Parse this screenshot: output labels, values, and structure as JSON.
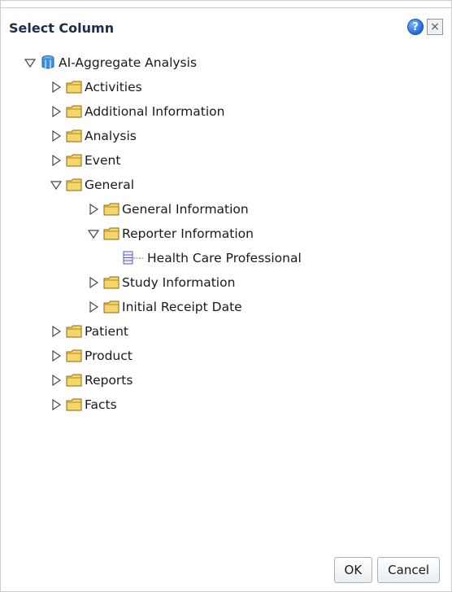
{
  "dialog": {
    "title": "Select Column",
    "help_icon_glyph": "?",
    "close_icon_glyph": "×"
  },
  "tree": {
    "root": {
      "label": "AI-Aggregate Analysis",
      "expanded": true,
      "icon": "cube-icon"
    },
    "items": [
      {
        "label": "Activities",
        "level": 1,
        "expanded": false,
        "icon": "folder-icon"
      },
      {
        "label": "Additional Information",
        "level": 1,
        "expanded": false,
        "icon": "folder-icon"
      },
      {
        "label": "Analysis",
        "level": 1,
        "expanded": false,
        "icon": "folder-icon"
      },
      {
        "label": "Event",
        "level": 1,
        "expanded": false,
        "icon": "folder-icon"
      },
      {
        "label": "General",
        "level": 1,
        "expanded": true,
        "icon": "folder-icon"
      },
      {
        "label": "General Information",
        "level": 2,
        "expanded": false,
        "icon": "folder-icon"
      },
      {
        "label": "Reporter Information",
        "level": 2,
        "expanded": true,
        "icon": "folder-icon"
      },
      {
        "label": "Health Care Professional",
        "level": 3,
        "leaf": true,
        "icon": "column-icon"
      },
      {
        "label": "Study Information",
        "level": 2,
        "expanded": false,
        "icon": "folder-icon"
      },
      {
        "label": "Initial Receipt Date",
        "level": 2,
        "expanded": false,
        "icon": "folder-icon"
      },
      {
        "label": "Patient",
        "level": 1,
        "expanded": false,
        "icon": "folder-icon"
      },
      {
        "label": "Product",
        "level": 1,
        "expanded": false,
        "icon": "folder-icon"
      },
      {
        "label": "Reports",
        "level": 1,
        "expanded": false,
        "icon": "folder-icon"
      },
      {
        "label": "Facts",
        "level": 1,
        "expanded": false,
        "icon": "folder-icon"
      }
    ]
  },
  "buttons": {
    "ok": "OK",
    "cancel": "Cancel"
  }
}
